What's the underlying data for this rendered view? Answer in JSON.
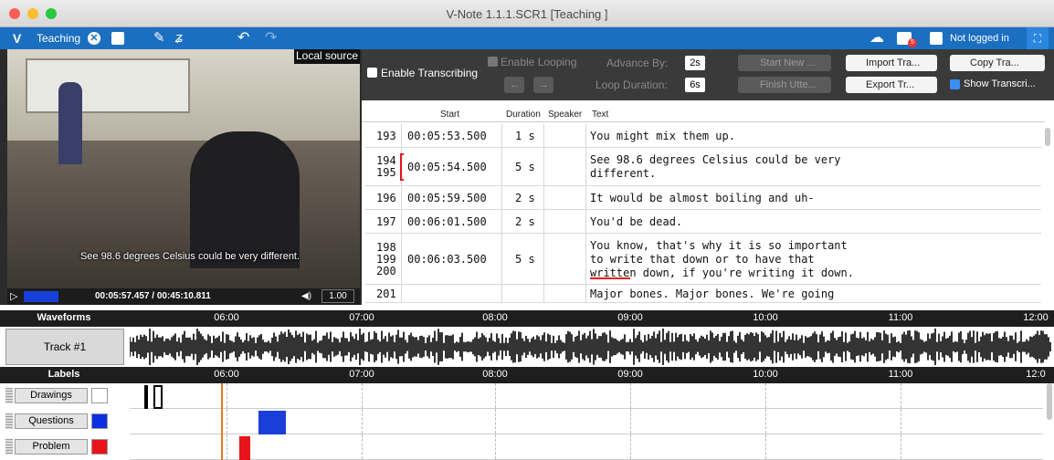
{
  "window": {
    "title": "V-Note 1.1.1.SCR1 [Teaching ]"
  },
  "toolbar": {
    "project_name": "Teaching",
    "login_label": "Not logged in",
    "notification_count": "5"
  },
  "video": {
    "source_label": "Local source",
    "subtitle": "See 98.6 degrees Celsius could be very different.",
    "timecode": "00:05:57.457 / 00:45:10.811",
    "speed": "1.00"
  },
  "transcription": {
    "enable_transcribing": "Enable Transcribing",
    "enable_looping": "Enable Looping",
    "advance_by_label": "Advance By:",
    "advance_by_value": "2s",
    "loop_duration_label": "Loop Duration:",
    "loop_duration_value": "6s",
    "start_new": "Start New ...",
    "finish_utterance": "Finish Utte...",
    "import": "Import Tra...",
    "export": "Export Tr...",
    "copy": "Copy Tra...",
    "show_transcript": "Show Transcri..."
  },
  "table": {
    "columns": [
      "Start",
      "Duration",
      "Speaker",
      "Text"
    ],
    "rows": [
      {
        "ids": "193",
        "start": "00:05:53.500",
        "duration": "1 s",
        "speaker": "",
        "text": "You might mix them up."
      },
      {
        "ids": "194\n195",
        "start": "00:05:54.500",
        "duration": "5 s",
        "speaker": "",
        "text": "See 98.6 degrees Celsius could be very\ndifferent."
      },
      {
        "ids": "196",
        "start": "00:05:59.500",
        "duration": "2 s",
        "speaker": "",
        "text": "It would be almost boiling and uh-"
      },
      {
        "ids": "197",
        "start": "00:06:01.500",
        "duration": "2 s",
        "speaker": "",
        "text": "You'd be dead."
      },
      {
        "ids": "198\n199\n200",
        "start": "00:06:03.500",
        "duration": "5 s",
        "speaker": "",
        "text": "You know, that's why it is so important\nto write that down or to have that\nwritten down, if you're writing it down."
      },
      {
        "ids": "201",
        "start": "",
        "duration": "",
        "speaker": "",
        "text": "Major bones. Major bones. We're going"
      }
    ]
  },
  "timeline": {
    "waveforms_label": "Waveforms",
    "labels_label": "Labels",
    "ticks": [
      "06:00",
      "07:00",
      "08:00",
      "09:00",
      "10:00",
      "11:00",
      "12:00"
    ],
    "ticks_labels_row": [
      "06:00",
      "07:00",
      "08:00",
      "09:00",
      "10:00",
      "11:00",
      "12:0"
    ],
    "track_name": "Track #1",
    "label_rows": [
      {
        "name": "Drawings",
        "key": "",
        "color": "#ffffff"
      },
      {
        "name": "Questions",
        "key": "Q",
        "color": "#0a2fe0"
      },
      {
        "name": "Problem",
        "key": "P",
        "color": "#e8141a"
      }
    ]
  },
  "colors": {
    "accent": "#1b6fc1",
    "playhead": "#e27a1c"
  }
}
